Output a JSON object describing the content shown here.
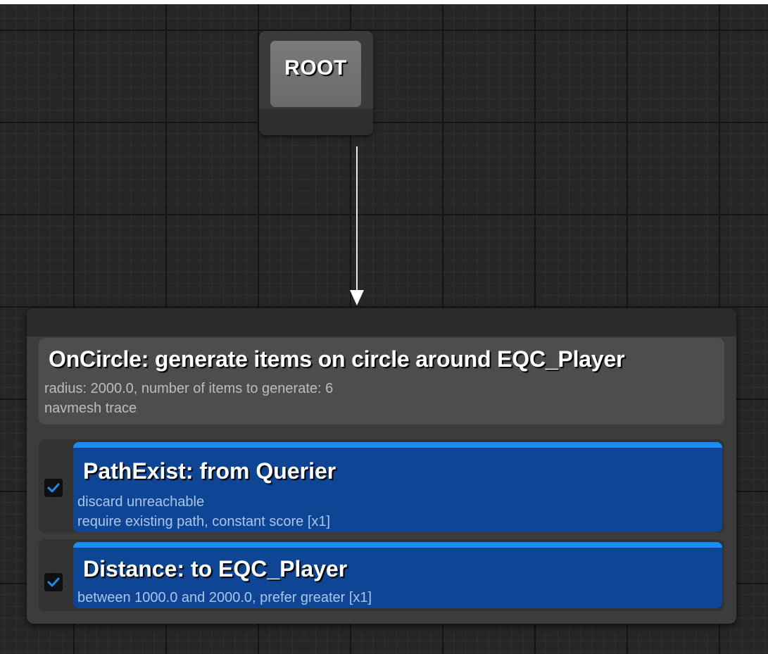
{
  "root": {
    "label": "ROOT"
  },
  "generator": {
    "title": "OnCircle: generate items on circle around EQC_Player",
    "details": [
      "radius: 2000.0, number of items to generate: 6",
      "navmesh trace"
    ]
  },
  "tests": [
    {
      "title": "PathExist: from Querier",
      "enabled": true,
      "details": [
        "discard unreachable",
        "require existing path, constant score [x1]"
      ]
    },
    {
      "title": "Distance: to EQC_Player",
      "enabled": true,
      "details": [
        "between 1000.0 and 2000.0, prefer greater [x1]"
      ]
    }
  ],
  "colors": {
    "canvas_background": "#262626",
    "node_background": "#3c3c3c",
    "test_card": "#0e4595",
    "test_card_accent": "#1a8cf2",
    "check_mark": "#1a8cf2"
  },
  "icons": {
    "checkbox": "check-icon",
    "connector": "arrow-down-icon"
  }
}
